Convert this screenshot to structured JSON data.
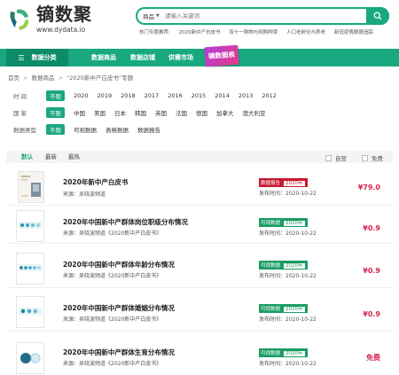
{
  "brand": {
    "name": "镝数聚",
    "url": "www.dydata.io"
  },
  "search": {
    "category": "商品",
    "placeholder": "请输入关键词"
  },
  "hot": {
    "label": "热门专题推荐:",
    "items": [
      "2020新中产白皮书",
      "双十一购物与网购种草",
      "人口老龄化与养老",
      "新冠疫情数据追踪"
    ]
  },
  "nav": {
    "category_label": "数据分类",
    "items": [
      "数据商品",
      "数据店铺",
      "供需市场"
    ],
    "badge": "镝数图表"
  },
  "breadcrumb": [
    "首页",
    "数据商品",
    "“2020新中产白皮书”专题"
  ],
  "filters": {
    "time": {
      "label": "时间",
      "options": [
        "不限",
        "2020",
        "2019",
        "2018",
        "2017",
        "2016",
        "2015",
        "2014",
        "2013",
        "2012"
      ]
    },
    "country": {
      "label": "国家",
      "options": [
        "不限",
        "中国",
        "美国",
        "日本",
        "韩国",
        "英国",
        "法国",
        "德国",
        "加拿大",
        "澳大利亚"
      ]
    },
    "type": {
      "label": "数据类型",
      "options": [
        "不限",
        "可视数据",
        "表格数据",
        "数据报告"
      ]
    }
  },
  "sort": {
    "options": [
      "默认",
      "最新",
      "最热"
    ],
    "self_op": "自营",
    "free": "免费"
  },
  "items": [
    {
      "title": "2020年新中产白皮书",
      "source": "来源：吴晓波频道",
      "tag": "数据报告",
      "tag_color": "#c8192e",
      "year": "2020年",
      "date": "发布时间：2020-10-22",
      "price": "¥79.0"
    },
    {
      "title": "2020年中国新中产群体岗位职级分布情况",
      "source": "来源：吴晓波频道《2020新中产白皮书》",
      "tag": "可视数据",
      "tag_color": "#1a9c63",
      "year": "2020年",
      "date": "发布时间：2020-10-22",
      "price": "¥0.9"
    },
    {
      "title": "2020年中国新中产群体年龄分布情况",
      "source": "来源：吴晓波频道《2020新中产白皮书》",
      "tag": "可视数据",
      "tag_color": "#1a9c63",
      "year": "2020年",
      "date": "发布时间：2020-10-22",
      "price": "¥0.9"
    },
    {
      "title": "2020年中国新中产群体婚姻分布情况",
      "source": "来源：吴晓波频道《2020新中产白皮书》",
      "tag": "可视数据",
      "tag_color": "#1a9c63",
      "year": "2020年",
      "date": "发布时间：2020-10-22",
      "price": "¥0.9"
    },
    {
      "title": "2020年中国新中产群体生育分布情况",
      "source": "来源：吴晓波频道《2020新中产白皮书》",
      "tag": "可视数据",
      "tag_color": "#1a9c63",
      "year": "2020年",
      "date": "发布时间：2020-10-22",
      "price": "免费"
    }
  ],
  "colors": {
    "accent": "#19a880",
    "price": "#d6254e"
  }
}
